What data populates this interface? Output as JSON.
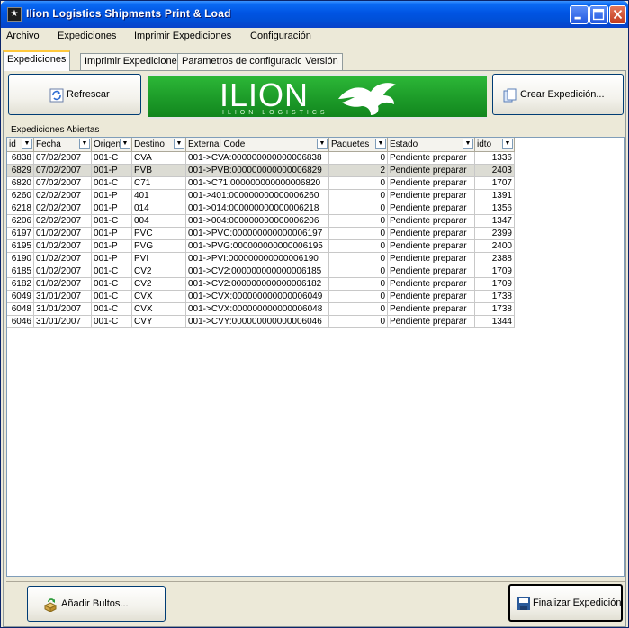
{
  "window": {
    "title": "Ilion Logistics Shipments Print & Load",
    "icon": "app-icon"
  },
  "menu": [
    {
      "label": "Archivo"
    },
    {
      "label": "Expediciones"
    },
    {
      "label": "Imprimir Expediciones"
    },
    {
      "label": "Configuración"
    }
  ],
  "tabs": [
    {
      "label": "Expediciones",
      "active": true
    },
    {
      "label": "Imprimir Expediciones",
      "active": false
    },
    {
      "label": "Parametros de configuracion",
      "active": false
    },
    {
      "label": "Versión",
      "active": false
    }
  ],
  "toolbar": {
    "refresh_label": "Refrescar",
    "create_label": "Crear Expedición...",
    "banner_word": "ILION",
    "banner_sub": "ILION LOGISTICS"
  },
  "grid": {
    "group_label": "Expediciones Abiertas",
    "columns": [
      "id",
      "Fecha",
      "Origen",
      "Destino",
      "External Code",
      "Paquetes",
      "Estado",
      "idto"
    ],
    "rows": [
      {
        "id": "6838",
        "fecha": "07/02/2007",
        "origen": "001-C",
        "destino": "CVA",
        "code": "001->CVA:000000000000006838",
        "paquetes": "0",
        "estado": "Pendiente preparar",
        "idto": "1336"
      },
      {
        "id": "6829",
        "fecha": "07/02/2007",
        "origen": "001-P",
        "destino": "PVB",
        "code": "001->PVB:000000000000006829",
        "paquetes": "2",
        "estado": "Pendiente preparar",
        "idto": "2403"
      },
      {
        "id": "6820",
        "fecha": "07/02/2007",
        "origen": "001-C",
        "destino": "C71",
        "code": "001->C71:000000000000006820",
        "paquetes": "0",
        "estado": "Pendiente preparar",
        "idto": "1707"
      },
      {
        "id": "6260",
        "fecha": "02/02/2007",
        "origen": "001-P",
        "destino": "401",
        "code": "001->401:000000000000006260",
        "paquetes": "0",
        "estado": "Pendiente preparar",
        "idto": "1391"
      },
      {
        "id": "6218",
        "fecha": "02/02/2007",
        "origen": "001-P",
        "destino": "014",
        "code": "001->014:000000000000006218",
        "paquetes": "0",
        "estado": "Pendiente preparar",
        "idto": "1356"
      },
      {
        "id": "6206",
        "fecha": "02/02/2007",
        "origen": "001-C",
        "destino": "004",
        "code": "001->004:000000000000006206",
        "paquetes": "0",
        "estado": "Pendiente preparar",
        "idto": "1347"
      },
      {
        "id": "6197",
        "fecha": "01/02/2007",
        "origen": "001-P",
        "destino": "PVC",
        "code": "001->PVC:000000000000006197",
        "paquetes": "0",
        "estado": "Pendiente preparar",
        "idto": "2399"
      },
      {
        "id": "6195",
        "fecha": "01/02/2007",
        "origen": "001-P",
        "destino": "PVG",
        "code": "001->PVG:000000000000006195",
        "paquetes": "0",
        "estado": "Pendiente preparar",
        "idto": "2400"
      },
      {
        "id": "6190",
        "fecha": "01/02/2007",
        "origen": "001-P",
        "destino": "PVI",
        "code": "001->PVI:000000000000006190",
        "paquetes": "0",
        "estado": "Pendiente preparar",
        "idto": "2388"
      },
      {
        "id": "6185",
        "fecha": "01/02/2007",
        "origen": "001-C",
        "destino": "CV2",
        "code": "001->CV2:000000000000006185",
        "paquetes": "0",
        "estado": "Pendiente preparar",
        "idto": "1709"
      },
      {
        "id": "6182",
        "fecha": "01/02/2007",
        "origen": "001-C",
        "destino": "CV2",
        "code": "001->CV2:000000000000006182",
        "paquetes": "0",
        "estado": "Pendiente preparar",
        "idto": "1709"
      },
      {
        "id": "6049",
        "fecha": "31/01/2007",
        "origen": "001-C",
        "destino": "CVX",
        "code": "001->CVX:000000000000006049",
        "paquetes": "0",
        "estado": "Pendiente preparar",
        "idto": "1738"
      },
      {
        "id": "6048",
        "fecha": "31/01/2007",
        "origen": "001-C",
        "destino": "CVX",
        "code": "001->CVX:000000000000006048",
        "paquetes": "0",
        "estado": "Pendiente preparar",
        "idto": "1738"
      },
      {
        "id": "6046",
        "fecha": "31/01/2007",
        "origen": "001-C",
        "destino": "CVY",
        "code": "001->CVY:000000000000006046",
        "paquetes": "0",
        "estado": "Pendiente preparar",
        "idto": "1344"
      }
    ],
    "selected_row": 1
  },
  "footer": {
    "add_label": "Añadir Bultos...",
    "finish_label": "Finalizar Expedición"
  },
  "colors": {
    "titlebar": "#0054e3",
    "banner_green": "#1e9e2a",
    "panel": "#ece9d8",
    "selected_row": "#dcdcd4"
  }
}
